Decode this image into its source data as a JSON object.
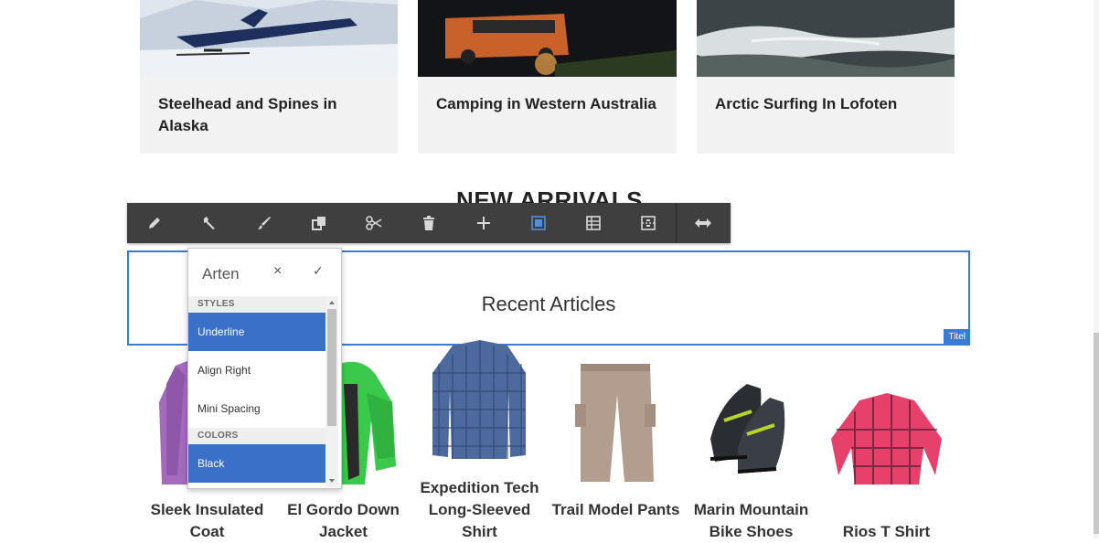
{
  "articles": [
    {
      "title": "Steelhead and Spines in Alaska"
    },
    {
      "title": "Camping in Western Australia"
    },
    {
      "title": "Arctic Surfing In Lofoten"
    }
  ],
  "section_heading": "NEW ARRIVALS",
  "toolbar": {
    "buttons": [
      "edit-icon",
      "wrench-icon",
      "paint-brush-icon",
      "copy-icon",
      "cut-icon",
      "delete-icon",
      "add-icon",
      "select-parent-icon",
      "layout-grid-icon",
      "group-icon",
      "resize-icon"
    ]
  },
  "component": {
    "title": "Recent Articles",
    "tag": "Titel"
  },
  "dropdown": {
    "input_value": "Arten",
    "clear": "×",
    "confirm": "✓",
    "sections": [
      {
        "label": "STYLES",
        "items": [
          {
            "label": "Underline",
            "selected": true
          },
          {
            "label": "Align Right",
            "selected": false
          },
          {
            "label": "Mini Spacing",
            "selected": false
          }
        ]
      },
      {
        "label": "COLORS",
        "items": [
          {
            "label": "Black",
            "selected": true
          }
        ]
      }
    ]
  },
  "products": [
    {
      "name": "Sleek Insulated Coat"
    },
    {
      "name": "El Gordo Down Jacket"
    },
    {
      "name": "Expedition Tech Long-Sleeved Shirt"
    },
    {
      "name": "Trail Model Pants"
    },
    {
      "name": "Marin Mountain Bike Shoes"
    },
    {
      "name": "Rios T Shirt"
    }
  ],
  "colors": {
    "accent": "#3a7bd5",
    "toolbar_bg": "#3f3f3f",
    "card_bg": "#f2f2f2"
  }
}
